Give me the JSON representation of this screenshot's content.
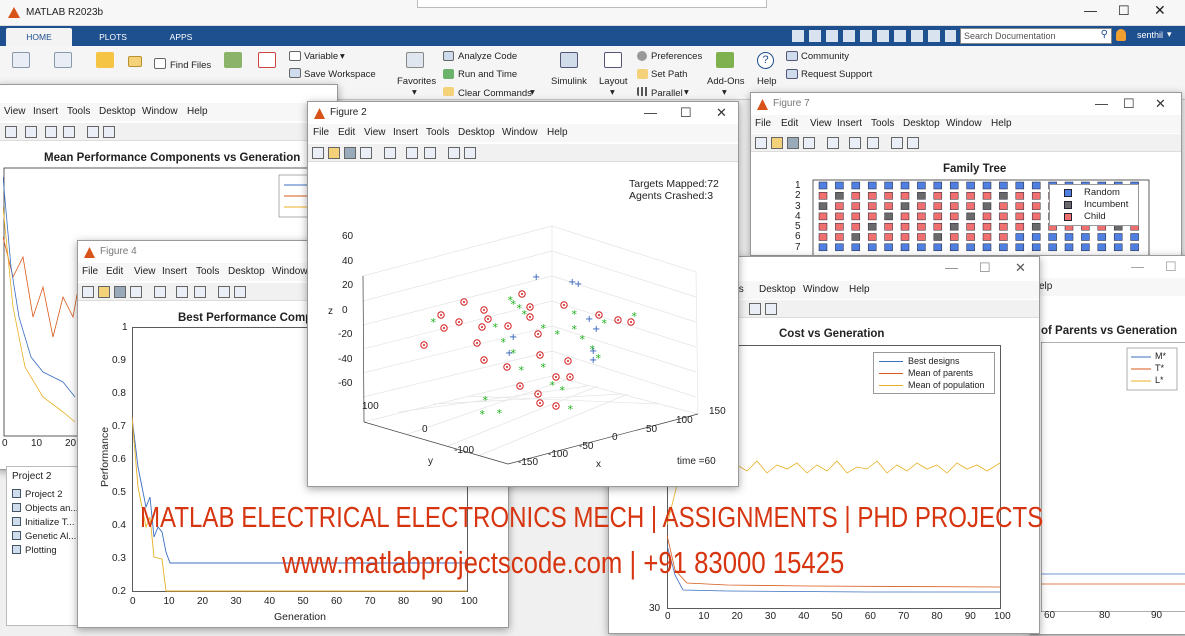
{
  "app": {
    "title": "MATLAB R2023b",
    "tabs": [
      "HOME",
      "PLOTS",
      "APPS"
    ],
    "search_placeholder": "Search Documentation",
    "user": "senthil"
  },
  "ribbon": {
    "find_files": "Find Files",
    "variable": "Variable",
    "save_workspace": "Save Workspace",
    "favorites": "Favorites",
    "analyze_code": "Analyze Code",
    "run_and_time": "Run and Time",
    "clear_commands": "Clear Commands",
    "simulink": "Simulink",
    "layout": "Layout",
    "preferences": "Preferences",
    "set_path": "Set Path",
    "parallel": "Parallel",
    "add_ons": "Add-Ons",
    "help": "Help",
    "community": "Community",
    "request_support": "Request Support"
  },
  "fig_back": {
    "menu": [
      "View",
      "Insert",
      "Tools",
      "Desktop",
      "Window",
      "Help"
    ],
    "title": "Mean Performance Components vs Generation",
    "xticks": [
      "0",
      "10",
      "20"
    ]
  },
  "project": {
    "header": "Project 2",
    "items": [
      "Project 2",
      "Objects an...",
      "Initialize T...",
      "Genetic Al...",
      "Plotting"
    ]
  },
  "fig4": {
    "window_title": "Figure 4",
    "menu": [
      "File",
      "Edit",
      "View",
      "Insert",
      "Tools",
      "Desktop",
      "Window"
    ],
    "plot_title": "Best Performance Comp",
    "ylabel": "Performance",
    "xlabel": "Generation",
    "yticks": [
      "1",
      "0.9",
      "0.8",
      "0.7",
      "0.6",
      "0.5",
      "0.4",
      "0.3",
      "0.2"
    ],
    "xticks": [
      "0",
      "10",
      "20",
      "30",
      "40",
      "50",
      "60",
      "70",
      "80",
      "90",
      "100"
    ]
  },
  "fig2": {
    "window_title": "Figure 2",
    "menu": [
      "File",
      "Edit",
      "View",
      "Insert",
      "Tools",
      "Desktop",
      "Window",
      "Help"
    ],
    "targets": "Targets Mapped:72",
    "agents": "Agents Crashed:3",
    "time": "time =60",
    "zlabel": "z",
    "ylabel": "y",
    "xlabel": "x",
    "zticks": [
      "60",
      "40",
      "20",
      "0",
      "-20",
      "-40",
      "-60"
    ],
    "yticks": [
      "100",
      "0",
      "-100"
    ],
    "xticks": [
      "-150",
      "-100",
      "-50",
      "0",
      "50",
      "100",
      "150"
    ]
  },
  "fig7": {
    "window_title": "Figure 7",
    "menu": [
      "File",
      "Edit",
      "View",
      "Insert",
      "Tools",
      "Desktop",
      "Window",
      "Help"
    ],
    "plot_title": "Family Tree",
    "legend": [
      "Random",
      "Incumbent",
      "Child"
    ],
    "yticks": [
      "1",
      "2",
      "3",
      "4",
      "5",
      "6",
      "7"
    ],
    "colors": {
      "random": "#4f7fe0",
      "incumbent": "#6a6a6a",
      "child": "#f07070"
    }
  },
  "fig_cost": {
    "menu": [
      "ols",
      "Desktop",
      "Window",
      "Help"
    ],
    "plot_title": "Cost vs Generation",
    "legend": [
      "Best designs",
      "Mean of parents",
      "Mean of population"
    ],
    "ytick": "30",
    "xticks": [
      "0",
      "10",
      "20",
      "30",
      "40",
      "50",
      "60",
      "70",
      "80",
      "90",
      "100"
    ],
    "colors": {
      "best": "#3b6fc0",
      "parents": "#d9591b",
      "population": "#e8b025"
    }
  },
  "fig_parents": {
    "menu_tail": "elp",
    "plot_title": "of Parents vs Generation",
    "legend": [
      "M*",
      "T*",
      "L*"
    ],
    "xticks": [
      "60",
      "80",
      "90"
    ]
  },
  "overlay": {
    "line1": "MATLAB ELECTRICAL ELECTRONICS MECH  | ASSIGNMENTS  |  PHD PROJECTS",
    "line2": "www.matlabprojectscode.com |  +91 83000 15425"
  }
}
